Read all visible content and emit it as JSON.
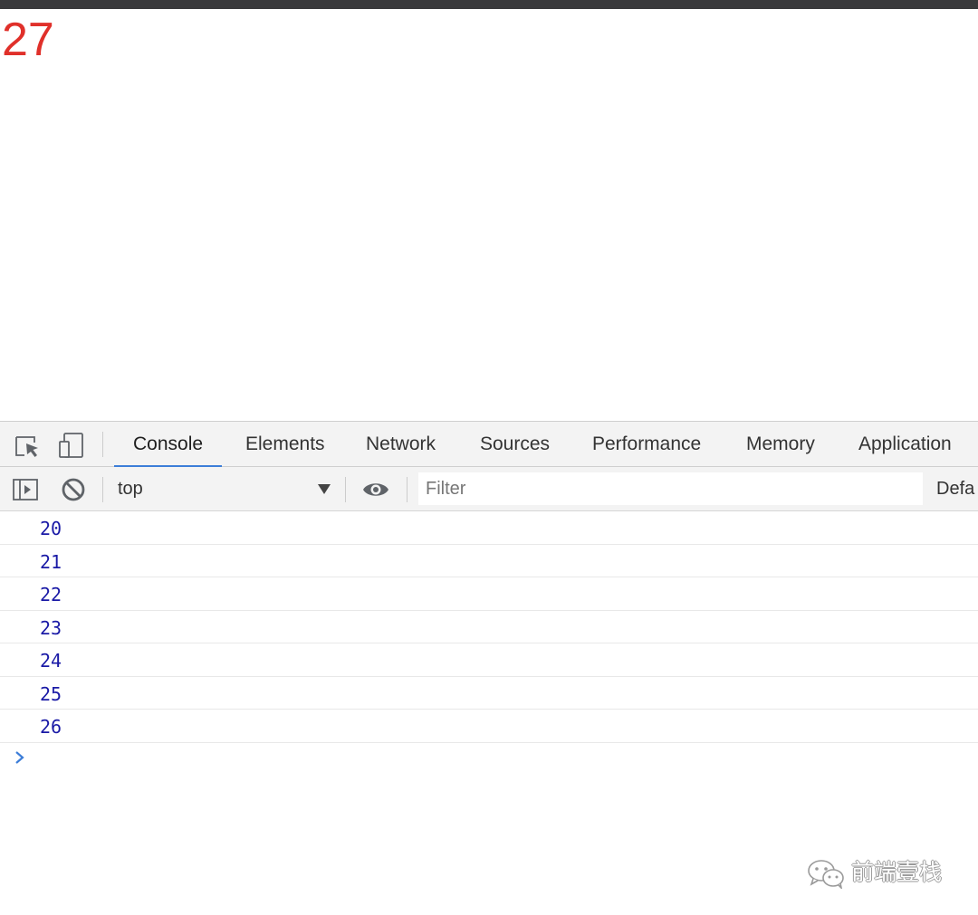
{
  "page": {
    "value": "27"
  },
  "devtools": {
    "tabs": [
      {
        "label": "Console",
        "active": true
      },
      {
        "label": "Elements",
        "active": false
      },
      {
        "label": "Network",
        "active": false
      },
      {
        "label": "Sources",
        "active": false
      },
      {
        "label": "Performance",
        "active": false
      },
      {
        "label": "Memory",
        "active": false
      },
      {
        "label": "Application",
        "active": false
      }
    ],
    "toolbar": {
      "context": "top",
      "filter_placeholder": "Filter",
      "levels_label": "Defa"
    },
    "console": {
      "logs": [
        "20",
        "21",
        "22",
        "23",
        "24",
        "25",
        "26"
      ]
    }
  },
  "watermark": {
    "text": "前端壹栈"
  },
  "colors": {
    "page_value": "#e0302a",
    "log_number": "#1a1aa6",
    "active_tab_underline": "#3c7dd8",
    "toolbar_bg": "#f3f3f3"
  },
  "icons": [
    "inspect-element-icon",
    "device-toolbar-icon",
    "sidebar-toggle-icon",
    "clear-console-icon",
    "dropdown-arrow-icon",
    "eye-icon",
    "prompt-chevron-icon",
    "wechat-icon"
  ]
}
